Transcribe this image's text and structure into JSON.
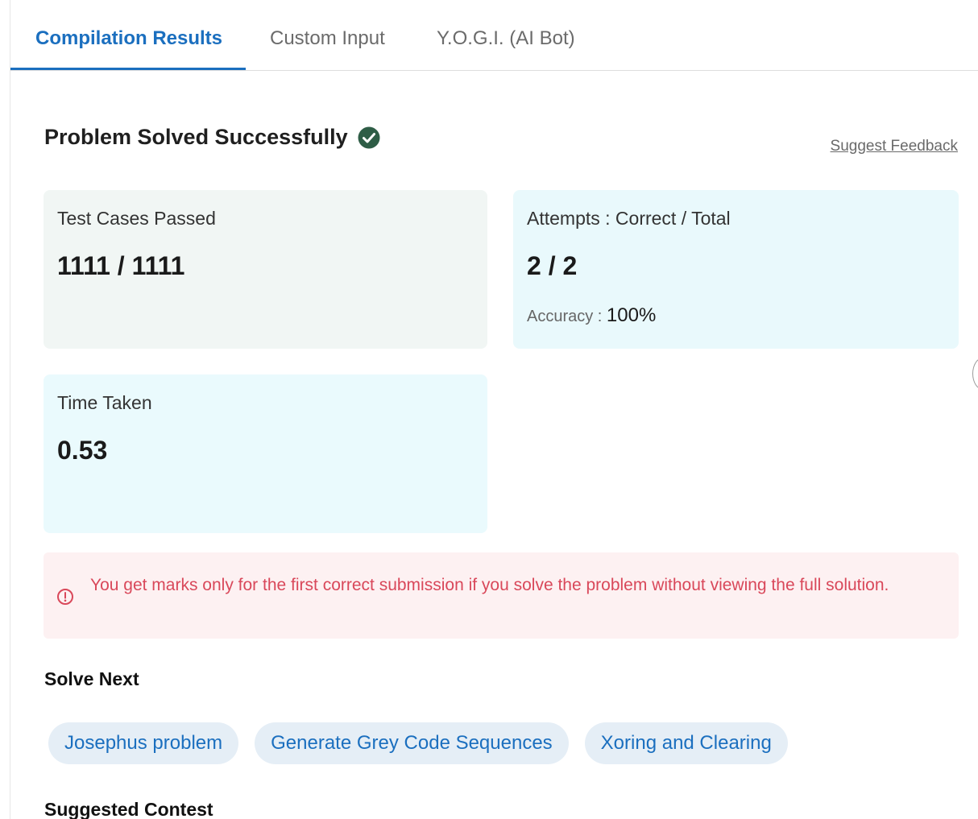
{
  "tabs": [
    {
      "label": "Compilation Results",
      "active": true
    },
    {
      "label": "Custom Input",
      "active": false
    },
    {
      "label": "Y.O.G.I. (AI Bot)",
      "active": false
    }
  ],
  "result": {
    "heading": "Problem Solved Successfully",
    "status_icon": "check-circle-icon",
    "feedback_link": "Suggest Feedback"
  },
  "stats": {
    "test_cases": {
      "label": "Test Cases Passed",
      "value": "1111 / 1111"
    },
    "attempts": {
      "label": "Attempts : Correct / Total",
      "value": "2 / 2",
      "accuracy_label": "Accuracy :",
      "accuracy_value": "100%"
    },
    "time": {
      "label": "Time Taken",
      "value": "0.53"
    }
  },
  "notice": {
    "icon": "info-circle-icon",
    "text": "You get marks only for the first correct submission if you solve the problem without viewing the full solution."
  },
  "solve_next": {
    "title": "Solve Next",
    "items": [
      "Josephus problem",
      "Generate Grey Code Sequences",
      "Xoring and Clearing"
    ]
  },
  "suggested_contest": {
    "title": "Suggested Contest"
  },
  "colors": {
    "accent": "#1b6fbf",
    "success": "#2e5d46",
    "error": "#d9485a"
  }
}
